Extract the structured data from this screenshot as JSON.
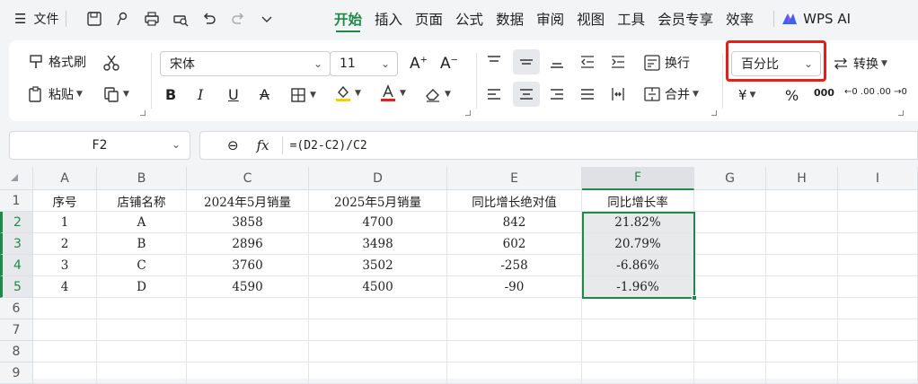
{
  "menu": {
    "file_label": "文件",
    "tabs": [
      "开始",
      "插入",
      "页面",
      "公式",
      "数据",
      "审阅",
      "视图",
      "工具",
      "会员专享",
      "效率"
    ],
    "active_tab": "开始",
    "ai_label": "WPS AI"
  },
  "ribbon": {
    "format_painter": "格式刷",
    "paste": "粘贴",
    "font_name": "宋体",
    "font_size": "11",
    "wrap_text": "换行",
    "merge": "合并",
    "number_format": "百分比",
    "convert": "转换",
    "currency_symbol": "¥",
    "percent_symbol": "%",
    "thousands_symbol": "000",
    "inc_decimal": "←0 .00",
    "dec_decimal": ".00 →0"
  },
  "formula_bar": {
    "name_box": "F2",
    "fx": "fx",
    "formula": "=(D2-C2)/C2"
  },
  "sheet": {
    "columns": [
      "A",
      "B",
      "C",
      "D",
      "E",
      "F",
      "G",
      "H",
      "I"
    ],
    "rows": [
      "1",
      "2",
      "3",
      "4",
      "5",
      "6",
      "7",
      "8",
      "9"
    ],
    "header_row": [
      "序号",
      "店铺名称",
      "2024年5月销量",
      "2025年5月销量",
      "同比增长绝对值",
      "同比增长率"
    ],
    "data": [
      [
        "1",
        "A",
        "3858",
        "4700",
        "842",
        "21.82%"
      ],
      [
        "2",
        "B",
        "2896",
        "3498",
        "602",
        "20.79%"
      ],
      [
        "3",
        "C",
        "3760",
        "3502",
        "-258",
        "-6.86%"
      ],
      [
        "4",
        "D",
        "4590",
        "4500",
        "-90",
        "-1.96%"
      ]
    ],
    "selected_cell": "F2",
    "accent_color": "#1e8a4a",
    "highlight_color": "#e5201b"
  }
}
